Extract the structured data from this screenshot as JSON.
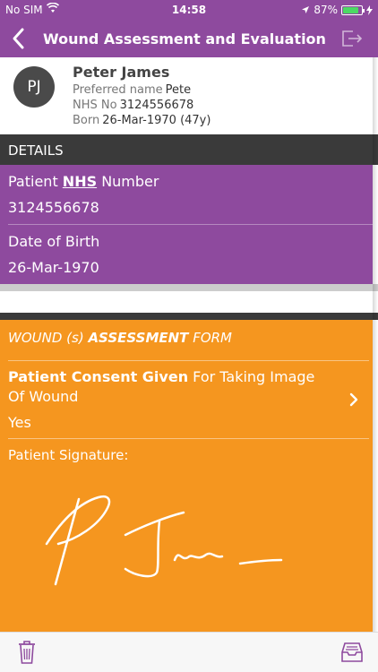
{
  "status_bar": {
    "carrier": "No SIM",
    "time": "14:58",
    "battery": "87%",
    "battery_level": 0.87
  },
  "nav": {
    "title": "Wound Assessment and Evaluation",
    "back_icon": "chevron-left-icon",
    "exit_icon": "exit-icon"
  },
  "patient": {
    "initials": "PJ",
    "name": "Peter James",
    "preferred_label": "Preferred name",
    "preferred_value": "Pete",
    "nhs_label": "NHS No",
    "nhs_value": "3124556678",
    "born_label": "Born",
    "born_value": "26-Mar-1970 (47y)"
  },
  "details": {
    "header": "DETAILS",
    "nhs_label_pre": "Patient ",
    "nhs_label_bold": "NHS",
    "nhs_label_post": " Number",
    "nhs_value": "3124556678",
    "dob_label": "Date of Birth",
    "dob_value": "26-Mar-1970"
  },
  "form": {
    "title_pre": "WOUND (s) ",
    "title_bold": "ASSESSMENT",
    "title_post": " FORM",
    "consent_bold": "Patient Consent Given",
    "consent_rest": " For Taking Image Of Wound",
    "consent_value": "Yes",
    "signature_label": "Patient Signature:"
  },
  "colors": {
    "purple": "#8e4a9e",
    "orange": "#f5961f",
    "dark": "#3a3a3a"
  },
  "toolbar": {
    "delete_icon": "trash-icon",
    "inbox_icon": "inbox-icon"
  }
}
